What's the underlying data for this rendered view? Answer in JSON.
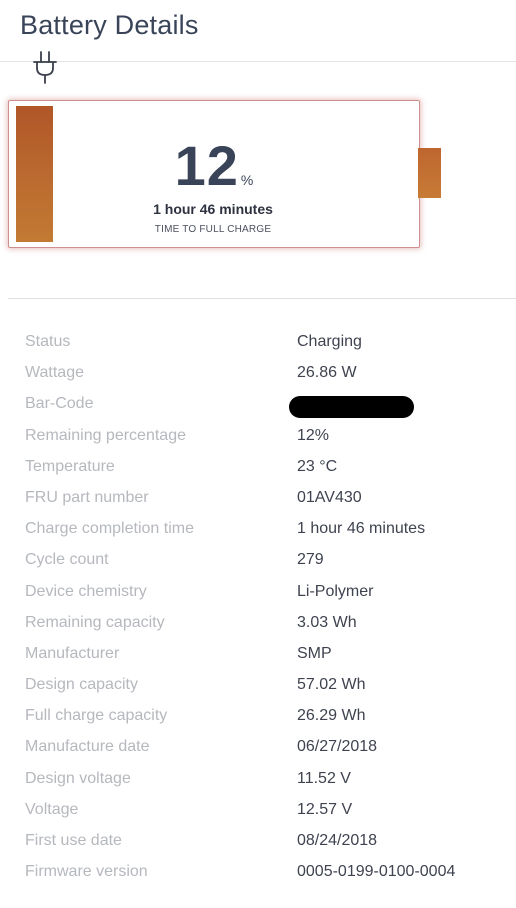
{
  "page": {
    "title": "Battery Details"
  },
  "battery_widget": {
    "percent_value": "12",
    "percent_unit": "%",
    "charge_level": 0.12,
    "time_to_full": "1 hour 46 minutes",
    "caption": "TIME TO FULL CHARGE",
    "icon": "plug-icon",
    "fill_color": "#b8612c"
  },
  "details": [
    {
      "label": "Status",
      "value": "Charging"
    },
    {
      "label": "Wattage",
      "value": "26.86 W"
    },
    {
      "label": "Bar-Code",
      "value": "",
      "redacted": true
    },
    {
      "label": "Remaining percentage",
      "value": "12%"
    },
    {
      "label": "Temperature",
      "value": "23 °C"
    },
    {
      "label": "FRU part number",
      "value": "01AV430"
    },
    {
      "label": "Charge completion time",
      "value": "1 hour 46 minutes"
    },
    {
      "label": "Cycle count",
      "value": "279"
    },
    {
      "label": "Device chemistry",
      "value": "Li-Polymer"
    },
    {
      "label": "Remaining capacity",
      "value": "3.03 Wh"
    },
    {
      "label": "Manufacturer",
      "value": "SMP"
    },
    {
      "label": "Design capacity",
      "value": "57.02 Wh"
    },
    {
      "label": "Full charge capacity",
      "value": "26.29 Wh"
    },
    {
      "label": "Manufacture date",
      "value": "06/27/2018"
    },
    {
      "label": "Design voltage",
      "value": "11.52 V"
    },
    {
      "label": "Voltage",
      "value": "12.57 V"
    },
    {
      "label": "First use date",
      "value": "08/24/2018"
    },
    {
      "label": "Firmware version",
      "value": "0005-0199-0100-0004"
    }
  ]
}
